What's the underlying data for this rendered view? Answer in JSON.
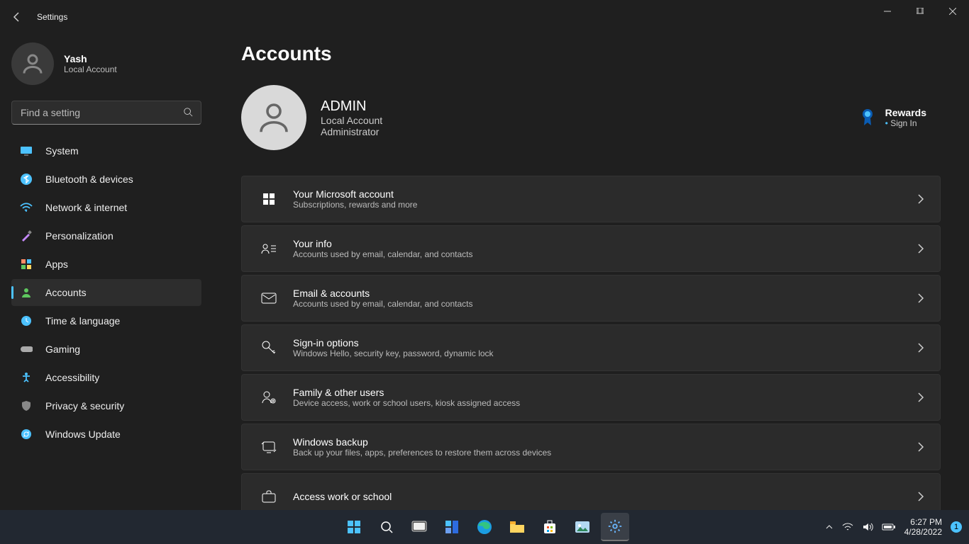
{
  "window": {
    "title": "Settings"
  },
  "sidebar": {
    "user": {
      "name": "Yash",
      "sub": "Local Account"
    },
    "search": {
      "placeholder": "Find a setting"
    },
    "items": [
      {
        "label": "System",
        "icon": "system-icon",
        "color": "#4cc2ff"
      },
      {
        "label": "Bluetooth & devices",
        "icon": "bluetooth-icon",
        "color": "#4cc2ff"
      },
      {
        "label": "Network & internet",
        "icon": "wifi-icon",
        "color": "#4cc2ff"
      },
      {
        "label": "Personalization",
        "icon": "brush-icon",
        "color": "#c58af9"
      },
      {
        "label": "Apps",
        "icon": "apps-icon",
        "color": "#ff8c66"
      },
      {
        "label": "Accounts",
        "icon": "person-icon",
        "color": "#5ec75e"
      },
      {
        "label": "Time & language",
        "icon": "clock-icon",
        "color": "#4cc2ff"
      },
      {
        "label": "Gaming",
        "icon": "gamepad-icon",
        "color": "#aaaaaa"
      },
      {
        "label": "Accessibility",
        "icon": "accessibility-icon",
        "color": "#4cc2ff"
      },
      {
        "label": "Privacy & security",
        "icon": "shield-icon",
        "color": "#888888"
      },
      {
        "label": "Windows Update",
        "icon": "update-icon",
        "color": "#4cc2ff"
      }
    ],
    "active_index": 5
  },
  "main": {
    "page_title": "Accounts",
    "account": {
      "name": "ADMIN",
      "line1": "Local Account",
      "line2": "Administrator"
    },
    "rewards": {
      "title": "Rewards",
      "sub": "Sign In"
    },
    "cards": [
      {
        "title": "Your Microsoft account",
        "sub": "Subscriptions, rewards and more",
        "icon": "windows-icon"
      },
      {
        "title": "Your info",
        "sub": "Accounts used by email, calendar, and contacts",
        "icon": "person-list-icon"
      },
      {
        "title": "Email & accounts",
        "sub": "Accounts used by email, calendar, and contacts",
        "icon": "mail-icon"
      },
      {
        "title": "Sign-in options",
        "sub": "Windows Hello, security key, password, dynamic lock",
        "icon": "key-icon"
      },
      {
        "title": "Family & other users",
        "sub": "Device access, work or school users, kiosk assigned access",
        "icon": "family-icon"
      },
      {
        "title": "Windows backup",
        "sub": "Back up your files, apps, preferences to restore them across devices",
        "icon": "backup-icon"
      },
      {
        "title": "Access work or school",
        "sub": "",
        "icon": "briefcase-icon"
      }
    ]
  },
  "taskbar": {
    "time": "6:27 PM",
    "date": "4/28/2022",
    "notif_count": "1"
  }
}
